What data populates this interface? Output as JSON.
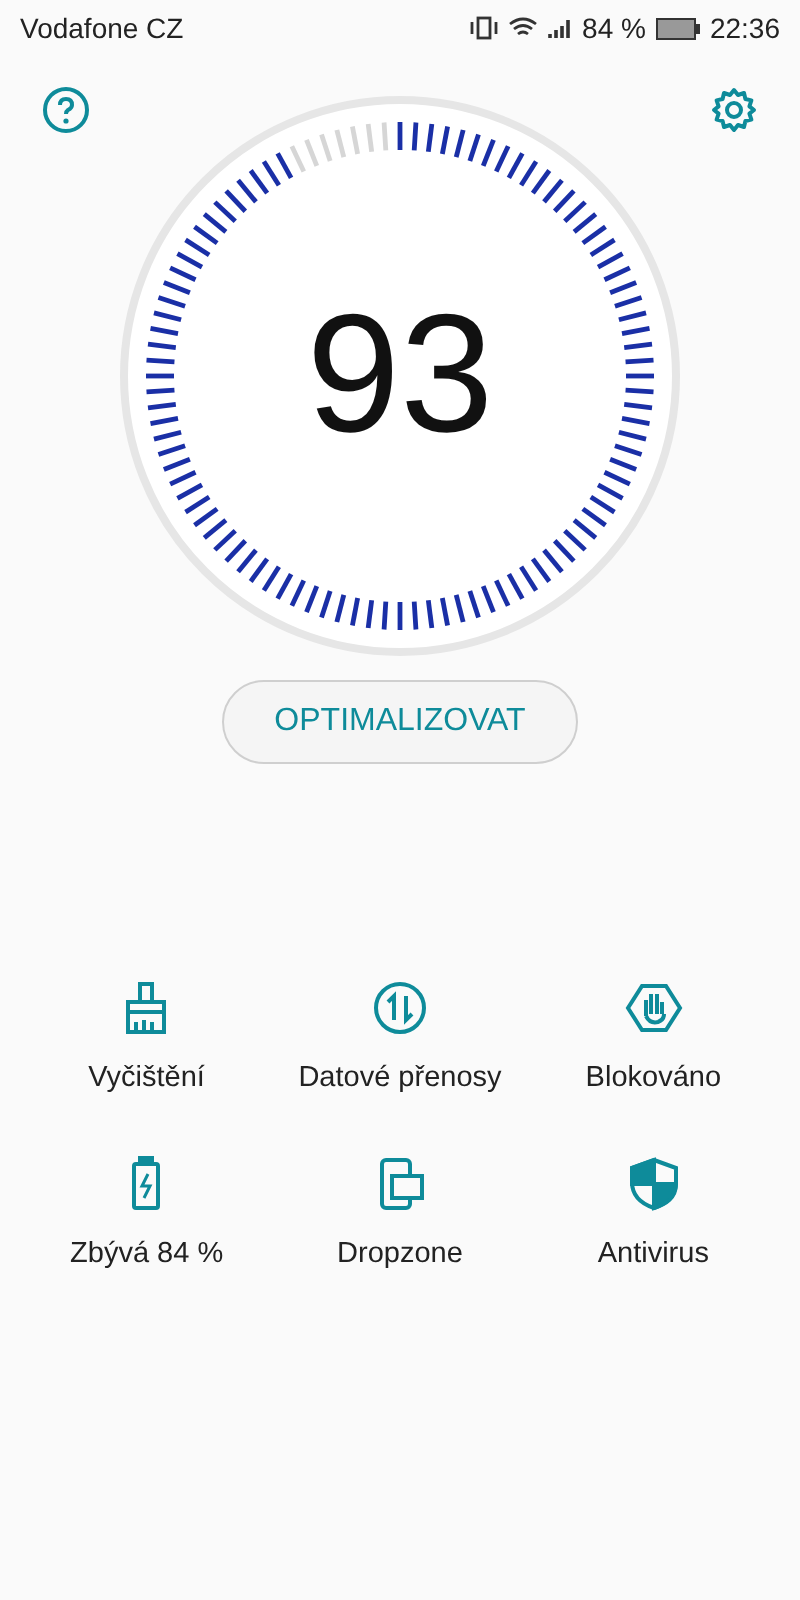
{
  "status_bar": {
    "carrier": "Vodafone CZ",
    "battery": "84 %",
    "time": "22:36"
  },
  "gauge": {
    "score": "93"
  },
  "optimize_button": "OPTIMALIZOVAT",
  "tools": [
    {
      "kind": "broom",
      "label": "Vyčištění"
    },
    {
      "kind": "transfer",
      "label": "Datové přenosy"
    },
    {
      "kind": "block",
      "label": "Blokováno"
    },
    {
      "kind": "battery",
      "label": "Zbývá 84 %"
    },
    {
      "kind": "dropzone",
      "label": "Dropzone"
    },
    {
      "kind": "shield",
      "label": "Antivirus"
    }
  ]
}
